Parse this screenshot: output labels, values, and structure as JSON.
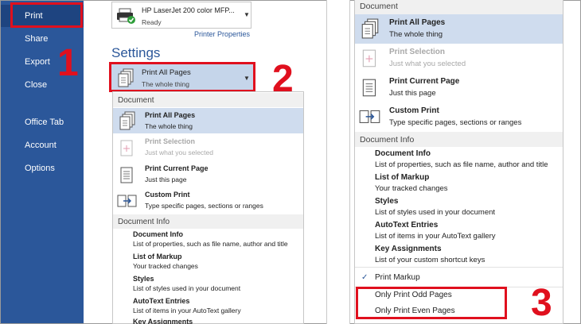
{
  "sidebar": {
    "items": [
      {
        "label": "Print"
      },
      {
        "label": "Share"
      },
      {
        "label": "Export"
      },
      {
        "label": "Close"
      },
      {
        "label": "Office Tab"
      },
      {
        "label": "Account"
      },
      {
        "label": "Options"
      }
    ]
  },
  "printer": {
    "name": "HP LaserJet 200 color MFP...",
    "status": "Ready",
    "properties_link": "Printer Properties"
  },
  "settings": {
    "title": "Settings",
    "selected": {
      "title": "Print All Pages",
      "desc": "The whole thing"
    }
  },
  "menu": {
    "document_header": "Document",
    "document_options": [
      {
        "title": "Print All Pages",
        "desc": "The whole thing",
        "icon": "all-pages-icon"
      },
      {
        "title": "Print Selection",
        "desc": "Just what you selected",
        "icon": "selection-icon"
      },
      {
        "title": "Print Current Page",
        "desc": "Just this page",
        "icon": "current-page-icon"
      },
      {
        "title": "Custom Print",
        "desc": "Type specific pages, sections or ranges",
        "icon": "custom-print-icon"
      }
    ],
    "info_header": "Document Info",
    "info_items": [
      {
        "title": "Document Info",
        "desc": "List of properties, such as file name, author and title"
      },
      {
        "title": "List of Markup",
        "desc": "Your tracked changes"
      },
      {
        "title": "Styles",
        "desc": "List of styles used in your document"
      },
      {
        "title": "AutoText Entries",
        "desc": "List of items in your AutoText gallery"
      },
      {
        "title": "Key Assignments",
        "desc": "List of your custom shortcut keys"
      }
    ],
    "print_markup": "Print Markup",
    "check_mark": "✓",
    "odd_pages": "Only Print Odd Pages",
    "even_pages": "Only Print Even Pages"
  },
  "callouts": {
    "n1": "1",
    "n2": "2",
    "n3": "3"
  },
  "colors": {
    "sidebar": "#2b579a",
    "highlight": "#e0101e",
    "selected_row": "#cfdcee"
  }
}
